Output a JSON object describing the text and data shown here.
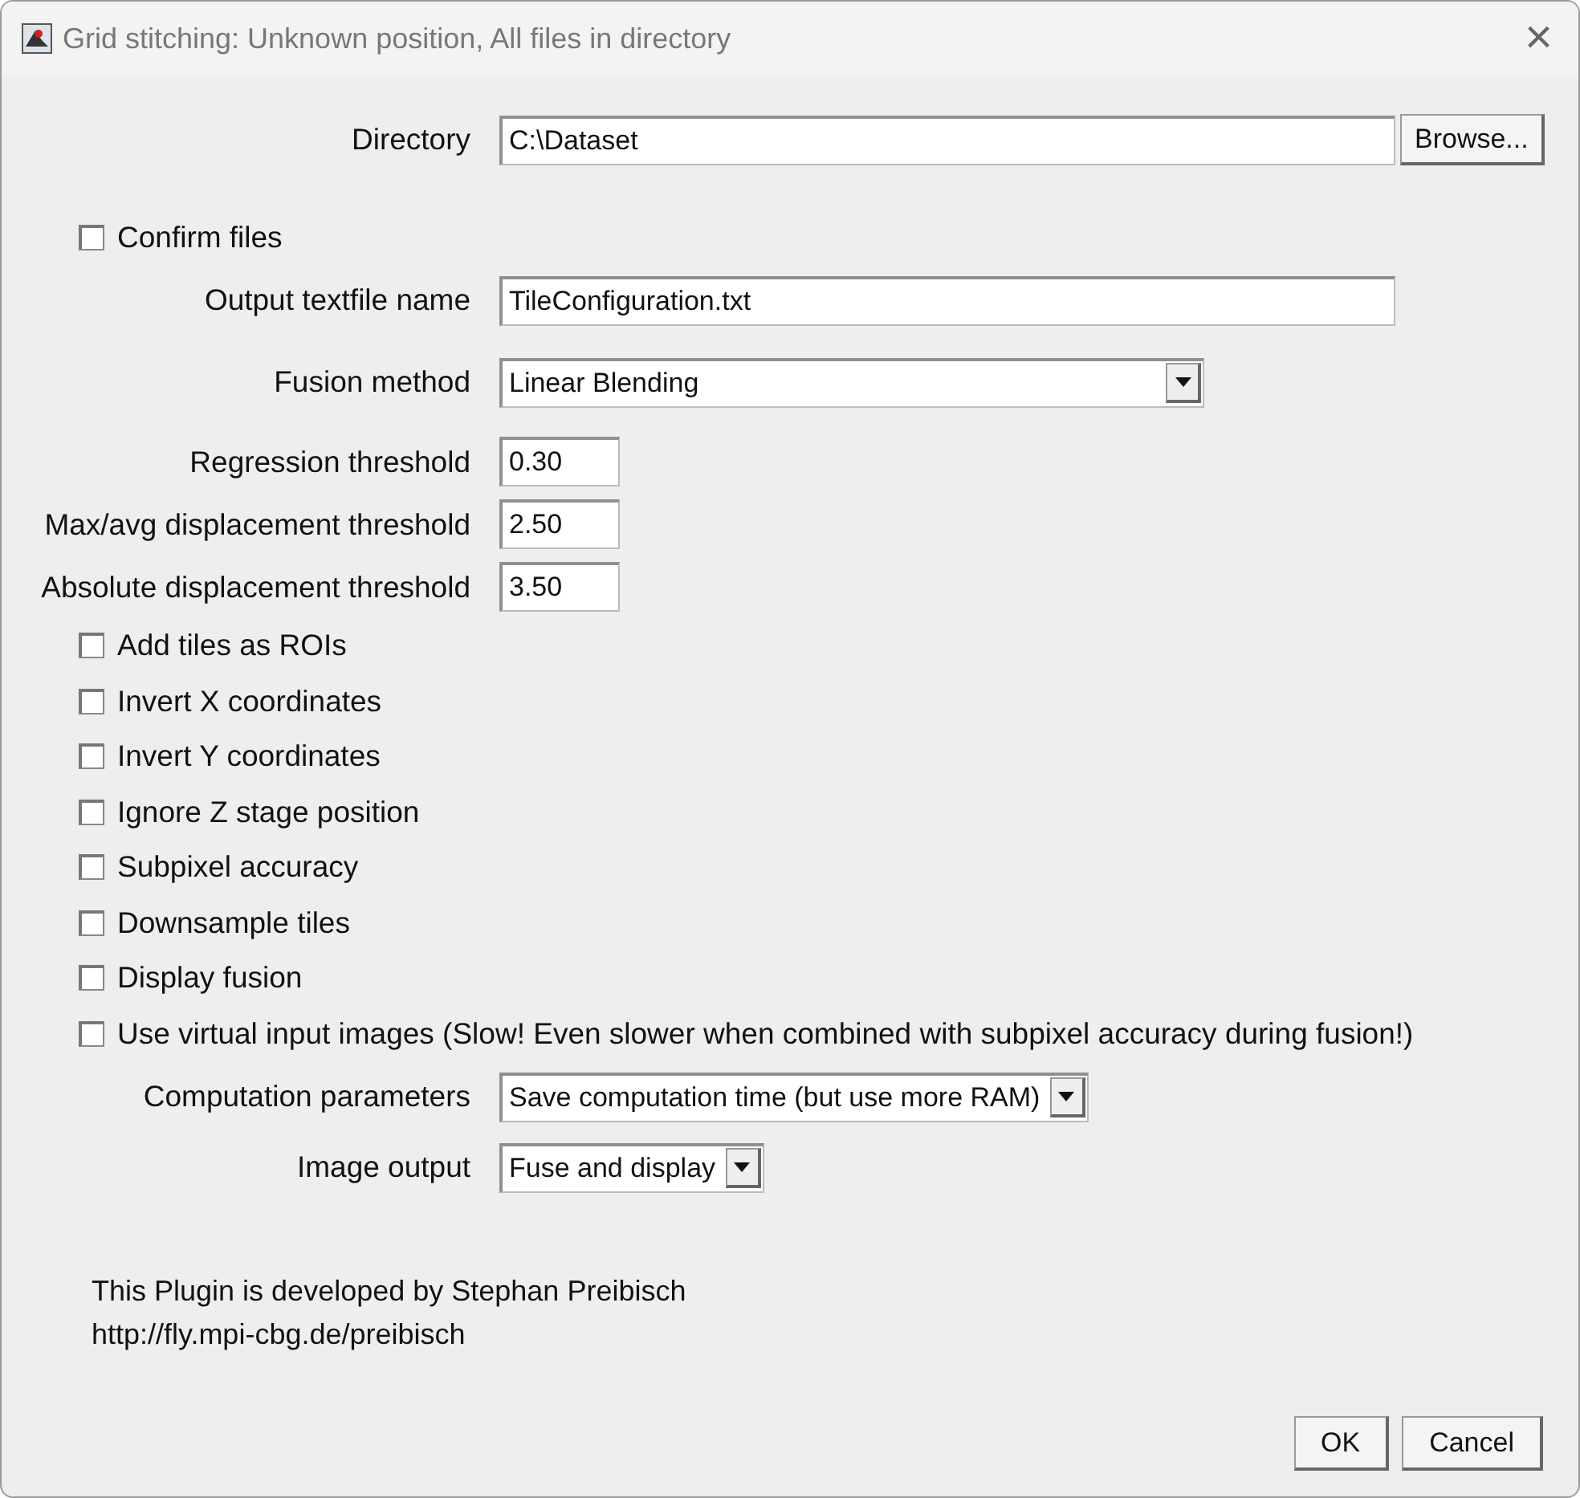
{
  "window": {
    "title": "Grid stitching: Unknown position, All files in directory",
    "close": "×"
  },
  "fields": [
    {
      "kind": "path",
      "label": "Directory",
      "value": "C:\\Dataset",
      "button": "Browse..."
    },
    {
      "kind": "checkbox",
      "label": "Confirm files",
      "checked": false
    },
    {
      "kind": "text",
      "label": "Output textfile name",
      "value": "TileConfiguration.txt"
    },
    {
      "kind": "choice",
      "label": "Fusion method",
      "value": "Linear Blending"
    },
    {
      "kind": "number",
      "label": "Regression threshold",
      "value": "0.30"
    },
    {
      "kind": "number",
      "label": "Max/avg displacement threshold",
      "value": "2.50"
    },
    {
      "kind": "number",
      "label": "Absolute displacement threshold",
      "value": "3.50"
    },
    {
      "kind": "checkbox",
      "label": "Add tiles as ROIs",
      "checked": false
    },
    {
      "kind": "checkbox",
      "label": "Invert X coordinates",
      "checked": false
    },
    {
      "kind": "checkbox",
      "label": "Invert Y coordinates",
      "checked": false
    },
    {
      "kind": "checkbox",
      "label": "Ignore Z stage position",
      "checked": false
    },
    {
      "kind": "checkbox",
      "label": "Subpixel accuracy",
      "checked": false
    },
    {
      "kind": "checkbox",
      "label": "Downsample tiles",
      "checked": false
    },
    {
      "kind": "checkbox",
      "label": "Display fusion",
      "checked": false
    },
    {
      "kind": "checkbox",
      "label": "Use virtual input images (Slow! Even slower when combined with subpixel accuracy during fusion!)",
      "checked": false
    },
    {
      "kind": "choice",
      "label": "Computation parameters",
      "value": "Save computation time (but use more RAM)"
    },
    {
      "kind": "choice",
      "label": "Image output",
      "value": "Fuse and display"
    }
  ],
  "footer": [
    "This Plugin is developed by Stephan Preibisch",
    "http://fly.mpi-cbg.de/preibisch"
  ],
  "buttons": [
    "OK",
    "Cancel"
  ]
}
